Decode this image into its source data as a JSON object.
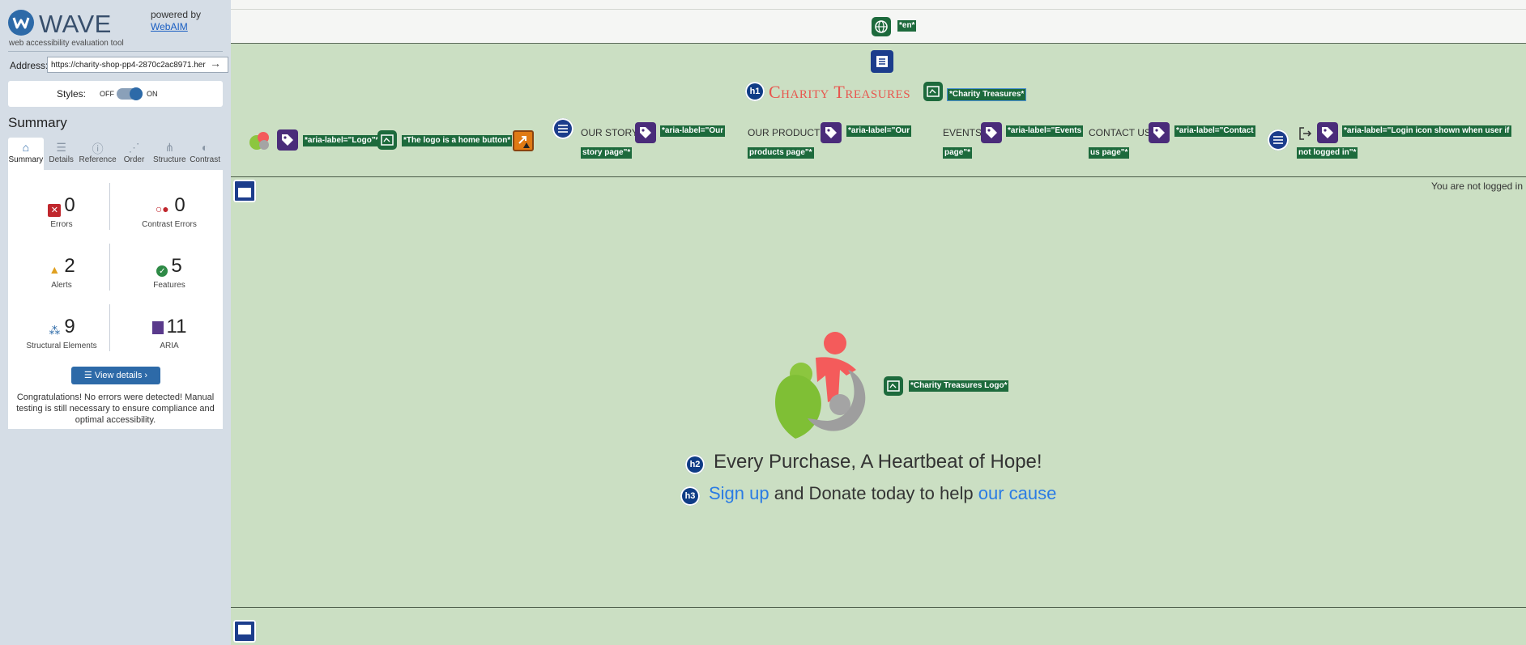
{
  "wave": {
    "name": "WAVE",
    "tagline": "web accessibility evaluation tool",
    "powered_by": "powered by",
    "webaim_link": "WebAIM",
    "address_label": "Address:",
    "address_value": "https://charity-shop-pp4-2870c2ac8971.her",
    "styles_label": "Styles:",
    "styles_off": "OFF",
    "styles_on": "ON",
    "summary_title": "Summary",
    "tabs": [
      {
        "label": "Summary",
        "icon": "home-icon",
        "glyph": "⌂"
      },
      {
        "label": "Details",
        "icon": "list-icon",
        "glyph": "☰"
      },
      {
        "label": "Reference",
        "icon": "info-icon",
        "glyph": "ⓘ"
      },
      {
        "label": "Order",
        "icon": "order-icon",
        "glyph": "⋰"
      },
      {
        "label": "Structure",
        "icon": "structure-icon",
        "glyph": "⋔"
      },
      {
        "label": "Contrast",
        "icon": "contrast-icon",
        "glyph": "◐"
      }
    ],
    "stats": {
      "errors": {
        "count": "0",
        "label": "Errors",
        "color": "#c0272d"
      },
      "contrast_errors": {
        "count": "0",
        "label": "Contrast Errors",
        "color": "#c0272d"
      },
      "alerts": {
        "count": "2",
        "label": "Alerts",
        "color": "#e0a020"
      },
      "features": {
        "count": "5",
        "label": "Features",
        "color": "#2e8a46"
      },
      "structural": {
        "count": "9",
        "label": "Structural Elements",
        "color": "#2d6aa8"
      },
      "aria": {
        "count": "11",
        "label": "ARIA",
        "color": "#5a3a8c"
      }
    },
    "view_details": "View details ›",
    "congrats": "Congratulations! No errors were detected! Manual testing is still necessary to ensure compliance and optimal accessibility."
  },
  "page": {
    "lang_label": "*en*",
    "heading_h1": "h1",
    "site_title": "Charity Treasures",
    "title_link_label": "*Charity Treasures*",
    "logo_aria": "*aria-label=\"Logo\"*",
    "logo_home_label": "*The logo is a home button*",
    "nav": [
      {
        "text": "OUR STORY",
        "aria_line1": "*aria-label=\"Our",
        "aria_line2": "story page\"*"
      },
      {
        "text": "OUR PRODUCTS",
        "aria_line1": "*aria-label=\"Our",
        "aria_line2": "products page\"*"
      },
      {
        "text": "EVENTS",
        "aria_line1": "*aria-label=\"Events",
        "aria_line2": "page\"*"
      },
      {
        "text": "CONTACT US",
        "aria_line1": "*aria-label=\"Contact",
        "aria_line2": "us page\"*"
      }
    ],
    "login_aria_line1": "*aria-label=\"Login icon shown when user if",
    "login_aria_line2": "not logged in\"*",
    "not_logged": "You are not logged in",
    "hero_logo_label": "*Charity Treasures Logo*",
    "h2_badge": "h2",
    "h3_badge": "h3",
    "hero_h2": "Every Purchase, A Heartbeat of Hope!",
    "hero_h3_link1": "Sign up",
    "hero_h3_mid": " and Donate today to help ",
    "hero_h3_link2": "our cause",
    "colors": {
      "accent_green": "#1d6a3c",
      "page_bg": "#cbdfc3",
      "title_red": "#e8564e",
      "link_blue": "#2a7be4"
    }
  }
}
